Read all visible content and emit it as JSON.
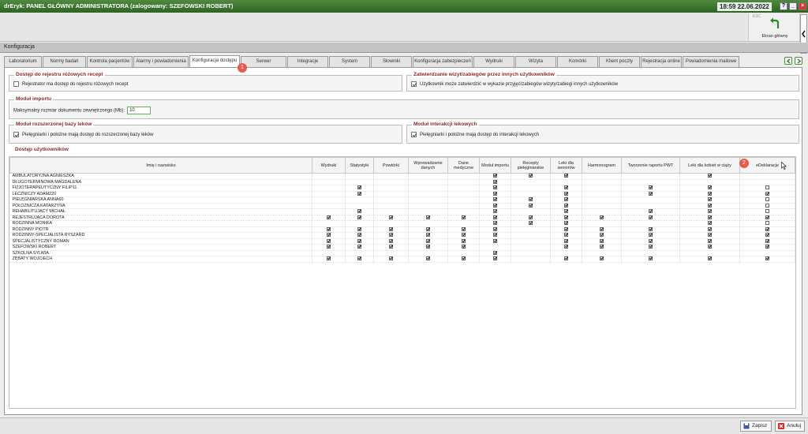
{
  "window": {
    "title": "drEryk: PANEL GŁÓWNY ADMINISTRATORA (zalogowany: SZEFOWSKI ROBERT)",
    "clock": "18:59 22.06.2022",
    "help": "?"
  },
  "toolbar": {
    "esc": "ESC",
    "home_label": "Ekran główny"
  },
  "section": {
    "title": "Konfiguracja"
  },
  "tabs": [
    "Laboratorium",
    "Normy badań",
    "Kontrola pacjentów",
    "Alarmy i powiadomienia",
    "Konfiguracja dostępu",
    "Serwer",
    "Integracje",
    "System",
    "Słowniki",
    "Konfiguracja zabezpieczeń",
    "Wydruki",
    "Wizyta",
    "Komórki",
    "Klient poczty",
    "Rejestracja online",
    "Powiadomienia mailowe"
  ],
  "active_tab": 4,
  "markers": {
    "m1": "1",
    "m2": "2"
  },
  "groups": {
    "pink": {
      "title": "Dostęp do rejestru różowych recept",
      "label": "Rejestrator ma dostęp do rejestru różowych recept",
      "checked": false
    },
    "visits": {
      "title": "Zatwierdzanie wizyt/zabiegów przez innych użytkowników",
      "label": "Użytkownik może zatwierdzić w wykazie przyjęć/zabiegów wizyty/zabiegi innych użytkowników",
      "checked": true
    },
    "import": {
      "title": "Moduł importu",
      "label": "Maksymalny rozmiar dokumentu zewnętrznego (Mb):",
      "value": "10"
    },
    "drugs": {
      "title": "Moduł rozszerzonej bazy leków",
      "label": "Pielęgniarki i położne mają dostęp do rozszerzonej bazy leków",
      "checked": true
    },
    "interactions": {
      "title": "Moduł interakcji lekowych",
      "label": "Pielęgniarki i położne mają dostęp do interakcji lekowych",
      "checked": true
    },
    "users": {
      "title": "Dostęp użytkowników"
    }
  },
  "table": {
    "columns": [
      "Imię i nazwisko",
      "Wydruki",
      "Statystyki",
      "Powtórki",
      "Wprowadzanie danych",
      "Dane medyczne",
      "Moduł importu",
      "Recepty pielęgniarskie",
      "Leki dla seniorów",
      "Harmonogram",
      "Tworzenie raportu PWT",
      "Leki dla kobiet w ciąży",
      "eDeklaracje"
    ],
    "rows": [
      {
        "name": "AMBULATORYJNA AGNIESZKA",
        "v": [
          0,
          0,
          0,
          0,
          0,
          1,
          1,
          1,
          0,
          0,
          1,
          null
        ]
      },
      {
        "name": "DŁUGOTERMINOWA MAGDALENA",
        "v": [
          0,
          0,
          0,
          0,
          0,
          1,
          0,
          0,
          0,
          0,
          0,
          null
        ]
      },
      {
        "name": "FIZJOTERAPEUTYCZNY FILIP11",
        "v": [
          0,
          1,
          0,
          0,
          0,
          1,
          0,
          1,
          0,
          1,
          1,
          0
        ]
      },
      {
        "name": "LECZNICZY ADAM220",
        "v": [
          0,
          1,
          0,
          0,
          0,
          1,
          0,
          1,
          0,
          1,
          1,
          1
        ]
      },
      {
        "name": "PIELĘGNIARSKA ANNA60",
        "v": [
          0,
          0,
          0,
          0,
          0,
          1,
          1,
          1,
          0,
          0,
          1,
          0
        ]
      },
      {
        "name": "POŁOŻNICZA KATARZYNA",
        "v": [
          0,
          0,
          0,
          0,
          0,
          1,
          1,
          1,
          0,
          0,
          1,
          0
        ]
      },
      {
        "name": "REHABILITUJĄCY MICHAŁ",
        "v": [
          0,
          1,
          0,
          0,
          0,
          1,
          0,
          1,
          0,
          1,
          1,
          0
        ]
      },
      {
        "name": "REJESTRUJĄCA DOROTA",
        "v": [
          1,
          1,
          1,
          1,
          1,
          1,
          1,
          1,
          1,
          1,
          1,
          1
        ]
      },
      {
        "name": "RODZINNA MONIKA",
        "v": [
          0,
          0,
          0,
          0,
          0,
          1,
          1,
          1,
          0,
          0,
          1,
          0
        ]
      },
      {
        "name": "RODZINNY PIOTR",
        "v": [
          1,
          1,
          1,
          1,
          1,
          1,
          0,
          1,
          1,
          1,
          1,
          1
        ]
      },
      {
        "name": "RODZINNY-SPECJALISTA RYSZARD",
        "v": [
          1,
          1,
          1,
          1,
          1,
          1,
          0,
          1,
          1,
          1,
          1,
          1
        ]
      },
      {
        "name": "SPECJALISTYCZNY ROMAN",
        "v": [
          1,
          1,
          1,
          1,
          1,
          1,
          0,
          1,
          1,
          1,
          1,
          1
        ]
      },
      {
        "name": "SZEFOWSKI ROBERT",
        "v": [
          1,
          1,
          1,
          1,
          1,
          0,
          0,
          1,
          1,
          1,
          1,
          1
        ]
      },
      {
        "name": "SZKOLNA SYLWIA",
        "v": [
          0,
          0,
          0,
          0,
          0,
          1,
          0,
          0,
          0,
          0,
          0,
          null
        ]
      },
      {
        "name": "ZĘBATY WOJCIECH",
        "v": [
          1,
          1,
          1,
          1,
          1,
          1,
          0,
          1,
          1,
          1,
          1,
          1
        ]
      }
    ]
  },
  "buttons": {
    "save": "Zapisz",
    "cancel": "Anuluj"
  },
  "colors": {
    "titlebar": "#2f6324",
    "group_title": "#8a2a2a",
    "marker": "#e85a50"
  }
}
